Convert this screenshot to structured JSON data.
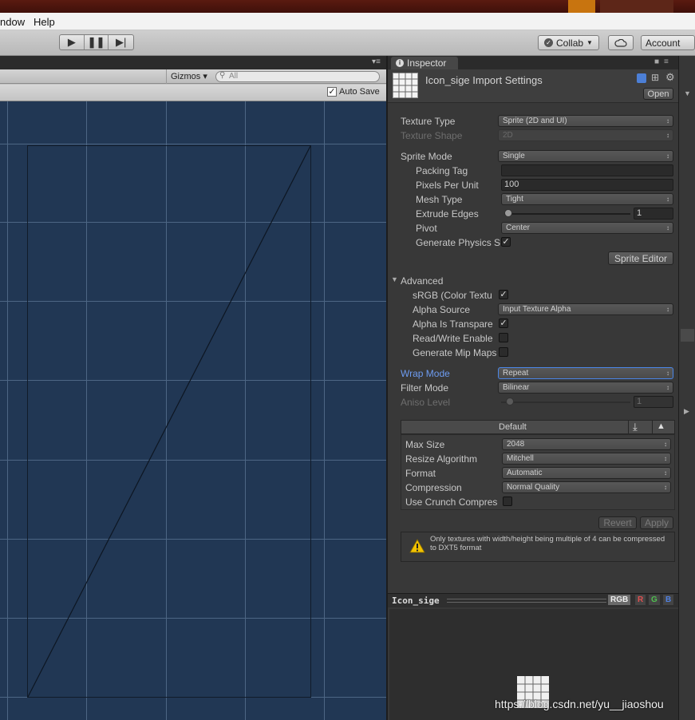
{
  "menu": {
    "items": [
      "ndow",
      "Help"
    ]
  },
  "toolbar": {
    "play_icon": "play-icon",
    "pause_icon": "pause-icon",
    "step_icon": "step-icon",
    "collab_label": "Collab",
    "account_label": "Account"
  },
  "scene": {
    "gizmos_label": "Gizmos",
    "search_placeholder": "All",
    "auto_save_label": "Auto Save",
    "auto_save_checked": true
  },
  "inspector": {
    "tab_label": "Inspector",
    "header_title": "Icon_sige Import Settings",
    "open_button": "Open",
    "fields": {
      "texture_type": {
        "label": "Texture Type",
        "value": "Sprite (2D and UI)"
      },
      "texture_shape": {
        "label": "Texture Shape",
        "value": "2D"
      },
      "sprite_mode": {
        "label": "Sprite Mode",
        "value": "Single"
      },
      "packing_tag": {
        "label": "Packing Tag",
        "value": ""
      },
      "pixels_per_unit": {
        "label": "Pixels Per Unit",
        "value": "100"
      },
      "mesh_type": {
        "label": "Mesh Type",
        "value": "Tight"
      },
      "extrude_edges": {
        "label": "Extrude Edges",
        "value": "1"
      },
      "pivot": {
        "label": "Pivot",
        "value": "Center"
      },
      "generate_physics": {
        "label": "Generate Physics S",
        "checked": true
      },
      "sprite_editor_button": "Sprite Editor",
      "advanced_label": "Advanced",
      "srgb": {
        "label": "sRGB (Color Textu",
        "checked": true
      },
      "alpha_source": {
        "label": "Alpha Source",
        "value": "Input Texture Alpha"
      },
      "alpha_transparency": {
        "label": "Alpha Is Transpare",
        "checked": true
      },
      "read_write": {
        "label": "Read/Write Enable",
        "checked": false
      },
      "generate_mips": {
        "label": "Generate Mip Maps",
        "checked": false
      },
      "wrap_mode": {
        "label": "Wrap Mode",
        "value": "Repeat"
      },
      "filter_mode": {
        "label": "Filter Mode",
        "value": "Bilinear"
      },
      "aniso_level": {
        "label": "Aniso Level",
        "value": "1"
      }
    },
    "platform": {
      "tab_label": "Default",
      "max_size": {
        "label": "Max Size",
        "value": "2048"
      },
      "resize_algorithm": {
        "label": "Resize Algorithm",
        "value": "Mitchell"
      },
      "format": {
        "label": "Format",
        "value": "Automatic"
      },
      "compression": {
        "label": "Compression",
        "value": "Normal Quality"
      },
      "use_crunch": {
        "label": "Use Crunch Compres",
        "checked": false
      }
    },
    "revert_button": "Revert",
    "apply_button": "Apply",
    "warning_text": "Only textures with width/height being multiple of 4 can be compressed to DXT5 format",
    "preview": {
      "name": "Icon_sige",
      "channels": [
        "RGB",
        "R",
        "G",
        "B"
      ],
      "channel_colors": {
        "RGB": "#d0d0d0",
        "R": "#e05050",
        "G": "#50c050",
        "B": "#5080e0"
      }
    }
  },
  "watermark": "https://blog.csdn.net/yu__jiaoshou"
}
